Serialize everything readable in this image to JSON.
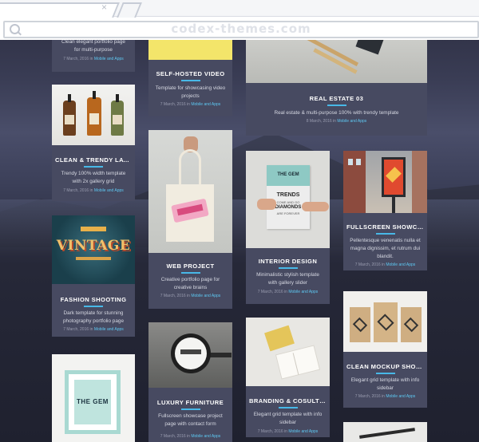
{
  "browser": {
    "url": "codex-themes.com",
    "tab_close": "×"
  },
  "cards": {
    "c0": {
      "desc": "Clean elegant portfolio page for multi-purpose",
      "date": "7 March, 2016 in",
      "cat": "Mobile and Apps"
    },
    "c1": {
      "title": "SELF-HOSTED VIDEO",
      "desc": "Template for showcasing video projects",
      "date": "7 March, 2016 in",
      "cat": "Mobile and Apps"
    },
    "c2": {
      "title": "REAL ESTATE 03",
      "desc": "Real estate & multi-purpose 100% with trendy template",
      "date": "8 March, 2016 in",
      "cat": "Mobile and Apps"
    },
    "c3": {
      "title": "CLEAN & TRENDY LAYO...",
      "desc": "Trendy 100% width template with 2x gallery grid",
      "date": "7 March, 2016 in",
      "cat": "Mobile and Apps"
    },
    "c4": {
      "title": "WEB PROJECT",
      "desc": "Creative portfolio page for creative brains",
      "date": "7 March, 2016 in",
      "cat": "Mobile and Apps",
      "img_text": ""
    },
    "c5": {
      "title": "INTERIOR DESIGN",
      "desc": "Minimalistic stylish template with gallery slider",
      "date": "7 March, 2016 in",
      "cat": "Mobile and Apps",
      "img_brand": "THE GEM",
      "img_line1": "TRENDS",
      "img_line2": "COME AND GO",
      "img_line3": "DIAMONDS",
      "img_line4": "ARE FOREVER"
    },
    "c6": {
      "title": "FULLSCREEN SHOWCA...",
      "desc": "Pellentesque venenatis nulla et magna dignissim, et rutrum dui blandit.",
      "date": "7 March, 2016 in",
      "cat": "Mobile and Apps"
    },
    "c7": {
      "title": "FASHION SHOOTING",
      "desc": "Dark template for stunning photography portfolio page",
      "date": "7 March, 2016 in",
      "cat": "Mobile and Apps",
      "img_text": "VINTAGE"
    },
    "c8": {
      "title": "LUXURY FURNITURE",
      "desc": "Fullscreen showcase project page with contact form",
      "date": "7 March, 2016 in",
      "cat": "Mobile and Apps"
    },
    "c9": {
      "title": "BRANDING & COSULTIN..",
      "desc": "Elegant grid template with info sidebar",
      "date": "7 March, 2016 in",
      "cat": "Mobile and Apps"
    },
    "c10": {
      "title": "CLEAN MOCKUP SHOW...",
      "desc": "Elegant grid template with info sidebar",
      "date": "7 March, 2016 in",
      "cat": "Mobile and Apps"
    },
    "c11": {
      "img_brand": "THE GEM"
    }
  }
}
